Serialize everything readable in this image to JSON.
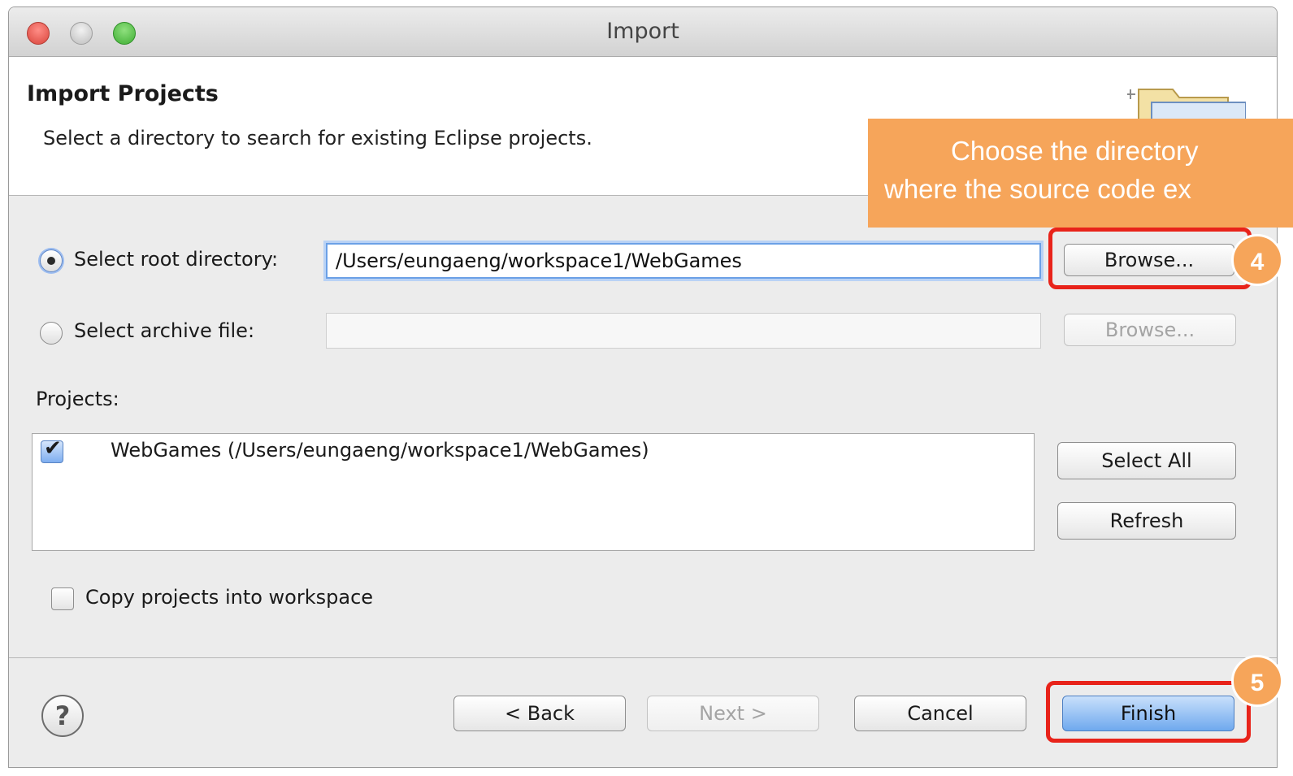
{
  "window": {
    "title": "Import"
  },
  "header": {
    "title": "Import Projects",
    "subtitle": "Select a directory to search for existing Eclipse projects."
  },
  "callout": {
    "line1": "Choose the directory",
    "line2": "where the source code ex"
  },
  "root": {
    "label": "Select root directory:",
    "value": "/Users/eungaeng/workspace1/WebGames",
    "browse_label": "Browse...",
    "selected": true
  },
  "archive": {
    "label": "Select archive file:",
    "value": "",
    "browse_label": "Browse..."
  },
  "projects": {
    "label": "Projects:",
    "items": [
      {
        "label": "WebGames (/Users/eungaeng/workspace1/WebGames)",
        "checked": true
      }
    ],
    "select_all_label": "Select All",
    "refresh_label": "Refresh"
  },
  "copy_option": {
    "label": "Copy projects into workspace",
    "checked": false
  },
  "footer": {
    "help_symbol": "?",
    "back_label": "< Back",
    "next_label": "Next >",
    "cancel_label": "Cancel",
    "finish_label": "Finish"
  },
  "annotations": {
    "step4": "4",
    "step5": "5"
  },
  "colors": {
    "callout": "#f6a55a",
    "highlight": "#e8231a",
    "primary": "#6fa9ee"
  },
  "icons": {
    "header": "folder-icon",
    "help": "help-icon"
  }
}
